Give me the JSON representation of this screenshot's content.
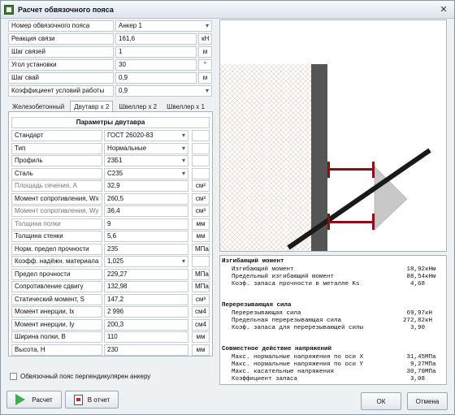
{
  "window": {
    "title": "Расчет обвязочного пояса",
    "close": "✕"
  },
  "top_params": [
    {
      "label": "Номер обвязочного пояса",
      "value": "Анкер  1",
      "unit": "",
      "dropdown": true
    },
    {
      "label": "Реакция связи",
      "value": "161,6",
      "unit": "кН",
      "dropdown": false
    },
    {
      "label": "Шаг связей",
      "value": "1",
      "unit": "м",
      "dropdown": false
    },
    {
      "label": "Угол установки",
      "value": "30",
      "unit": "°",
      "dropdown": false
    },
    {
      "label": "Шаг свай",
      "value": "0,9",
      "unit": "м",
      "dropdown": false
    },
    {
      "label": "Коэффициент условий работы",
      "value": "0,9",
      "unit": "",
      "dropdown": true
    }
  ],
  "tabs": [
    "Железобетонный",
    "Двутавр x 2",
    "Швеллер x 2",
    "Швеллер x 1"
  ],
  "active_tab": "Двутавр x 2",
  "panel_title": "Параметры двутавра",
  "params": [
    {
      "label": "Стандарт",
      "value": "ГОСТ 26020-83",
      "unit": "",
      "dropdown": true,
      "gray": false
    },
    {
      "label": "Тип",
      "value": "Нормальные",
      "unit": "",
      "dropdown": true,
      "gray": false
    },
    {
      "label": "Профиль",
      "value": "23Б1",
      "unit": "",
      "dropdown": true,
      "gray": false
    },
    {
      "label": "Сталь",
      "value": "С235",
      "unit": "",
      "dropdown": true,
      "gray": false
    },
    {
      "label": "Площадь сечения, А",
      "value": "32,9",
      "unit": "см²",
      "dropdown": false,
      "gray": true
    },
    {
      "label": "Момент сопротивления, Wx",
      "value": "260,5",
      "unit": "см³",
      "dropdown": false,
      "gray": false
    },
    {
      "label": "Момент сопротивления, Wy",
      "value": "36,4",
      "unit": "см³",
      "dropdown": false,
      "gray": true
    },
    {
      "label": "Толщина полки",
      "value": "9",
      "unit": "мм",
      "dropdown": false,
      "gray": true
    },
    {
      "label": "Толщина стенки",
      "value": "5,6",
      "unit": "мм",
      "dropdown": false,
      "gray": false
    },
    {
      "label": "Норм. предел прочности",
      "value": "235",
      "unit": "МПа",
      "dropdown": false,
      "gray": false
    },
    {
      "label": "Коэфф. надёжн. материала",
      "value": "1,025",
      "unit": "",
      "dropdown": true,
      "gray": false
    },
    {
      "label": "Предел прочности",
      "value": "229,27",
      "unit": "МПа",
      "dropdown": false,
      "gray": false
    },
    {
      "label": "Сопротивление сдвигу",
      "value": "132,98",
      "unit": "МПа",
      "dropdown": false,
      "gray": false
    },
    {
      "label": "Статический момент, S",
      "value": "147,2",
      "unit": "см³",
      "dropdown": false,
      "gray": false
    },
    {
      "label": "Момент инерции, Ix",
      "value": "2 996",
      "unit": "см4",
      "dropdown": false,
      "gray": false
    },
    {
      "label": "Момент инерции, Iy",
      "value": "200,3",
      "unit": "см4",
      "dropdown": false,
      "gray": false
    },
    {
      "label": "Ширина полки, B",
      "value": "110",
      "unit": "мм",
      "dropdown": false,
      "gray": false
    },
    {
      "label": "Высота, H",
      "value": "230",
      "unit": "мм",
      "dropdown": false,
      "gray": false
    }
  ],
  "perpendicular_checkbox": {
    "label": "Обвязочный пояс перпендикулярен анкеру",
    "checked": false
  },
  "buttons": {
    "calc": "Расчет",
    "report": "В отчет",
    "ok": "ОК",
    "cancel": "Отмена"
  },
  "results": [
    {
      "title": "Изгибающий момент",
      "lines": [
        {
          "label": "Изгибающий момент",
          "value": "18,92",
          "unit": "кНм"
        },
        {
          "label": "Предельный изгибающий момент",
          "value": "88,54",
          "unit": "кНм"
        },
        {
          "label": "Коэф. запаса прочности в металле Ks",
          "value": "4,68",
          "unit": ""
        }
      ]
    },
    {
      "title": "Перерезывающая сила",
      "lines": [
        {
          "label": "Перерезывающая сила",
          "value": "69,97",
          "unit": "кН"
        },
        {
          "label": "Предельная перерезывающая сила",
          "value": "272,82",
          "unit": "кН"
        },
        {
          "label": "Коэф. запаса для перерезывающей силы",
          "value": "3,90",
          "unit": ""
        }
      ]
    },
    {
      "title": "Совместное действие напряжений",
      "lines": [
        {
          "label": "Макс. нормальные напряжения по оси X",
          "value": "31,45",
          "unit": "МПа"
        },
        {
          "label": "Макс. нормальные напряжения по оси Y",
          "value": "9,27",
          "unit": "МПа"
        },
        {
          "label": "Макс. касательные напряжения",
          "value": "30,70",
          "unit": "МПа"
        },
        {
          "label": "Коэффициент запаса",
          "value": "3,08",
          "unit": ""
        }
      ]
    }
  ],
  "colors": {
    "wall": "#555555",
    "rod": "#1a1a1a",
    "beam": "#8b0d1a",
    "anchor": "#c8c8c8",
    "soil_hatch": "#e8b8a0"
  }
}
